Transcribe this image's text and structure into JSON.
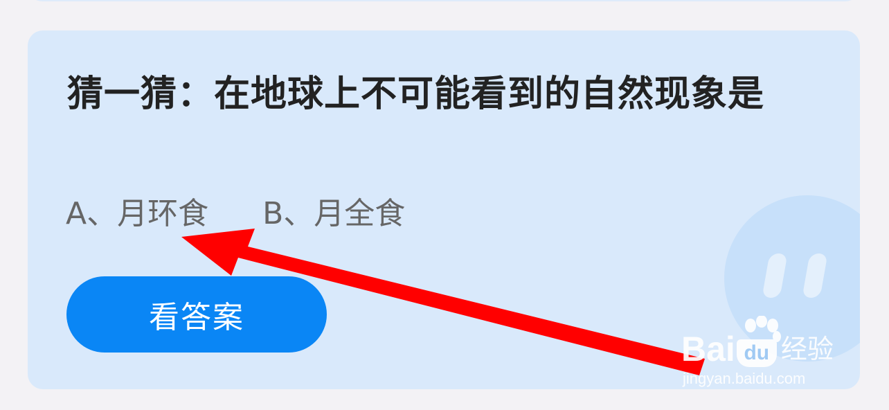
{
  "quiz": {
    "question": "猜一猜：在地球上不可能看到的自然现象是",
    "options": [
      {
        "label": "A、月环食"
      },
      {
        "label": "B、月全食"
      }
    ],
    "answer_button_label": "看答案"
  },
  "annotation": {
    "arrow_color": "#ff0000"
  },
  "watermark": {
    "logo_part1": "Bai",
    "logo_part2": "du",
    "logo_part3": "经验",
    "url": "jingyan.baidu.com"
  },
  "colors": {
    "background": "#f3f2f5",
    "card": "#d9e9fb",
    "button": "#0a86f5",
    "question_text": "#222222",
    "option_text": "#666666"
  }
}
